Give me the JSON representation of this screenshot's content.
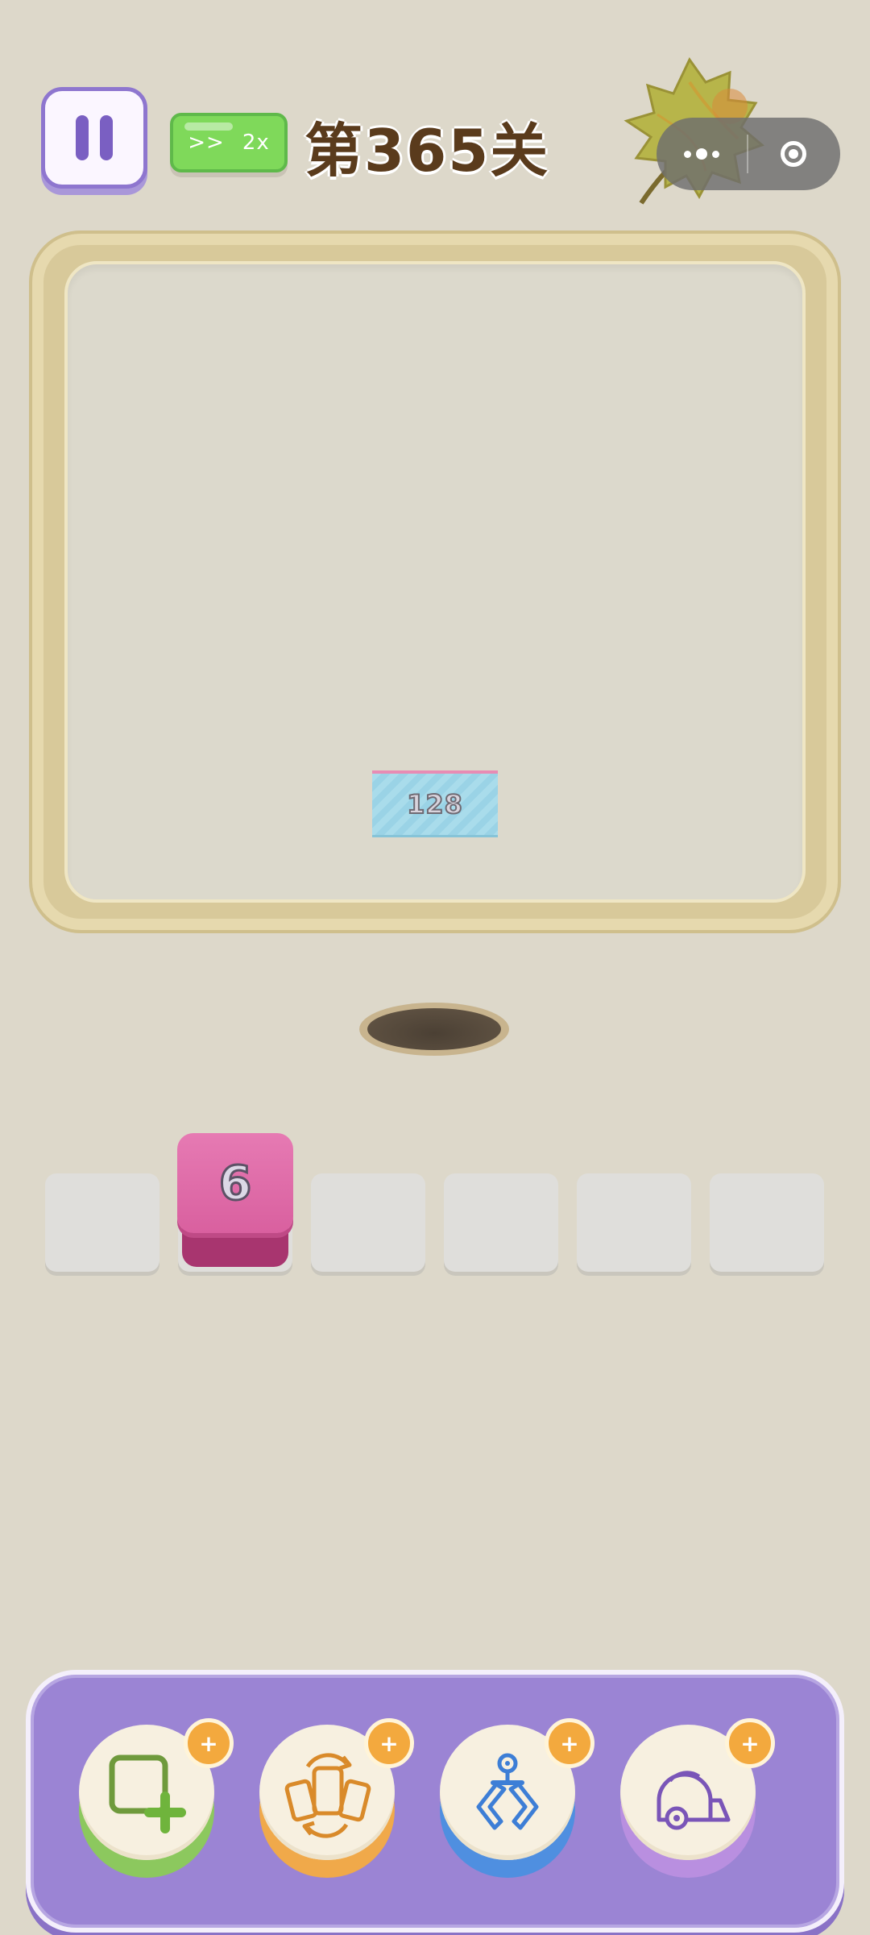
{
  "header": {
    "pause_icon": "pause-icon",
    "speed_arrows": ">>",
    "speed_label": "2x",
    "level_title": "第365关",
    "menu_icon": "more-dots-icon",
    "close_icon": "target-icon"
  },
  "board": {
    "tiles": [
      {
        "label": "128",
        "color": "#a9dceb"
      }
    ]
  },
  "slots": {
    "count": 6,
    "filled": [
      {
        "slot": 2,
        "label": "6",
        "color": "#e06aa8"
      }
    ]
  },
  "powerups": [
    {
      "icon": "add-slot-icon",
      "badge": "+",
      "color": "#8cc85e"
    },
    {
      "icon": "shuffle-icon",
      "badge": "+",
      "color": "#f0a94a"
    },
    {
      "icon": "claw-icon",
      "badge": "+",
      "color": "#4f8fe0"
    },
    {
      "icon": "vacuum-icon",
      "badge": "+",
      "color": "#b98fe0"
    }
  ],
  "colors": {
    "background": "#ddd8ca",
    "tray": "#9b84d4",
    "board_frame": "#d8c99a",
    "pause_accent": "#7a5fc2",
    "speed_button": "#7fd95a",
    "title": "#5a3b1c"
  }
}
